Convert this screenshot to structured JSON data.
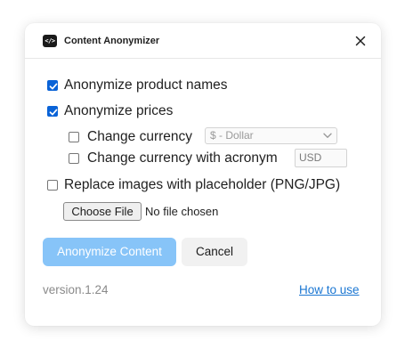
{
  "header": {
    "app_icon_glyph": "</>",
    "title": "Content Anonymizer",
    "close_icon": "close-icon"
  },
  "options": {
    "product_names": {
      "label": "Anonymize product names",
      "checked": true
    },
    "prices": {
      "label": "Anonymize prices",
      "checked": true
    },
    "change_currency": {
      "label": "Change currency",
      "checked": false,
      "selected_value": "$ - Dollar"
    },
    "change_currency_acronym": {
      "label": "Change currency with acronym",
      "checked": false,
      "placeholder": "USD"
    },
    "replace_images": {
      "label": "Replace images with placeholder (PNG/JPG)",
      "checked": false
    }
  },
  "file": {
    "button_label": "Choose File",
    "status": "No file chosen"
  },
  "actions": {
    "primary_label": "Anonymize Content",
    "secondary_label": "Cancel"
  },
  "footer": {
    "version": "version.1.24",
    "help_link": "How to use"
  },
  "colors": {
    "accent": "#0a63d7",
    "primary_disabled": "#87c4f8",
    "link": "#1a76d2"
  }
}
